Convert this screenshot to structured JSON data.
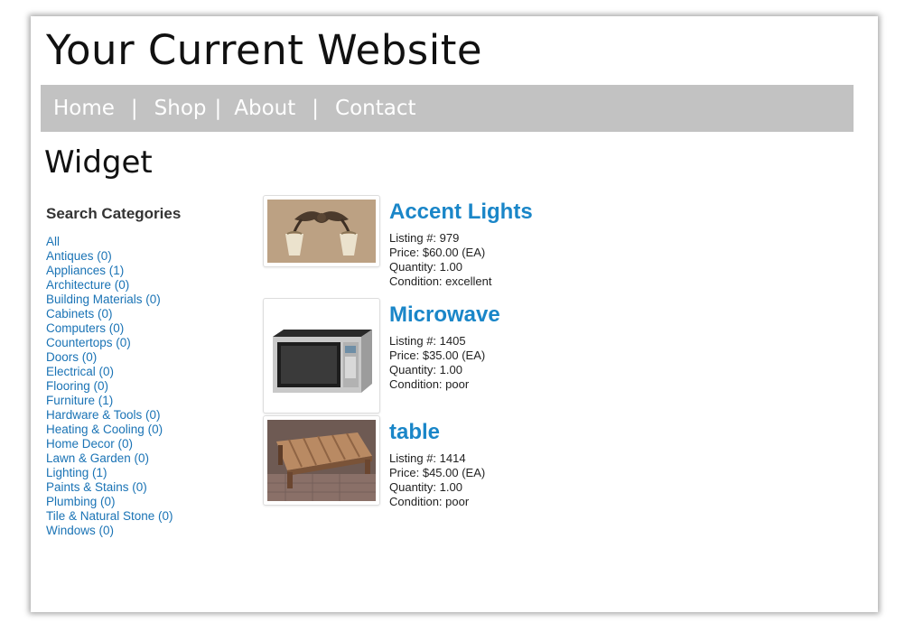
{
  "site": {
    "title": "Your Current Website"
  },
  "nav": {
    "items": [
      "Home",
      "Shop",
      "About",
      "Contact"
    ],
    "separator": "|"
  },
  "page": {
    "heading": "Widget"
  },
  "sidebar": {
    "heading": "Search Categories",
    "categories": [
      "All",
      "Antiques (0)",
      "Appliances (1)",
      "Architecture (0)",
      "Building Materials (0)",
      "Cabinets (0)",
      "Computers (0)",
      "Countertops (0)",
      "Doors (0)",
      "Electrical (0)",
      "Flooring (0)",
      "Furniture (1)",
      "Hardware & Tools (0)",
      "Heating & Cooling (0)",
      "Home Decor (0)",
      "Lawn & Garden (0)",
      "Lighting (1)",
      "Paints & Stains (0)",
      "Plumbing (0)",
      "Tile & Natural Stone (0)",
      "Windows (0)"
    ]
  },
  "listings": [
    {
      "title": "Accent Lights",
      "listing": "Listing #: 979",
      "price": "Price: $60.00 (EA)",
      "quantity": "Quantity: 1.00",
      "condition": "Condition: excellent",
      "image": "wall-sconce-photo"
    },
    {
      "title": "Microwave",
      "listing": "Listing #: 1405",
      "price": "Price: $35.00 (EA)",
      "quantity": "Quantity: 1.00",
      "condition": "Condition: poor",
      "image": "microwave-photo"
    },
    {
      "title": "table",
      "listing": "Listing #: 1414",
      "price": "Price: $45.00 (EA)",
      "quantity": "Quantity: 1.00",
      "condition": "Condition: poor",
      "image": "pallet-table-photo"
    }
  ],
  "colors": {
    "link": "#1a73b5",
    "listing_title": "#1a86c8",
    "nav_bar": "#c2c2c2"
  }
}
